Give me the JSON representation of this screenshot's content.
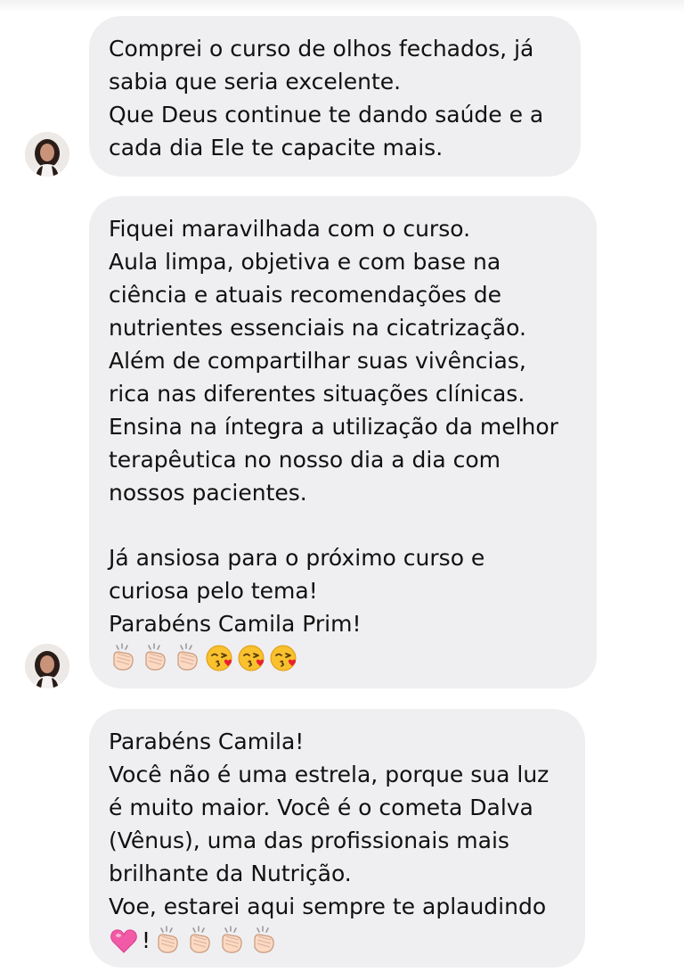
{
  "messages": [
    {
      "lines": [
        "Comprei o curso de olhos fechados, já",
        "sabia que seria excelente.",
        "Que Deus continue te dando saúde e a",
        "cada dia Ele te capacite mais."
      ]
    },
    {
      "lines": [
        "Fiquei maravilhada com o curso.",
        "Aula limpa, objetiva e com base na",
        "ciência e atuais recomendações de",
        "nutrientes essenciais na cicatrização.",
        "Além de compartilhar suas vivências,",
        "rica nas diferentes situações clínicas.",
        "Ensina na íntegra a  utilização da melhor",
        "terapêutica no nosso dia a dia com",
        "nossos pacientes."
      ],
      "lines_after_gap": [
        "Já ansiosa para o próximo curso e",
        "curiosa pelo tema!",
        "Parabéns Camila Prim!"
      ],
      "emojis": [
        "clapping-hands",
        "clapping-hands",
        "clapping-hands",
        "face-blowing-kiss",
        "face-blowing-kiss",
        "face-blowing-kiss"
      ]
    },
    {
      "lines": [
        "Parabéns Camila!",
        "Você não é uma estrela, porque sua luz",
        "é muito maior. Você é o cometa Dalva",
        "(Vênus), uma das profissionais mais",
        "brilhante da Nutrição.",
        "Voe, estarei aqui sempre te aplaudindo"
      ],
      "trailing_emoji_text": "!",
      "emojis_before_text": [
        "pink-heart"
      ],
      "emojis_after_text": [
        "clapping-hands",
        "clapping-hands",
        "clapping-hands",
        "clapping-hands"
      ]
    }
  ],
  "colors": {
    "bubble": "#efeff1",
    "text": "#111111"
  }
}
